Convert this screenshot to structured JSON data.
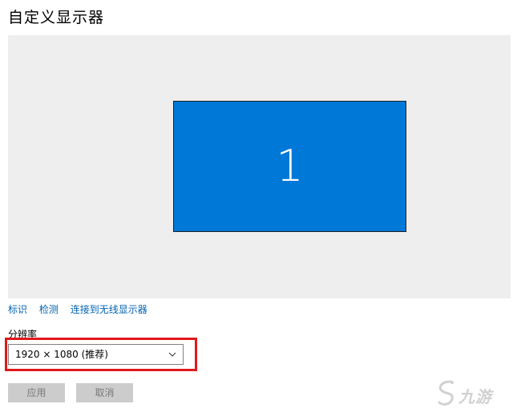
{
  "header": {
    "title": "自定义显示器"
  },
  "display": {
    "monitor_number": "1",
    "monitor_color": "#0078d7",
    "canvas_color": "#eeeeee"
  },
  "links": {
    "identify": "标识",
    "detect": "检测",
    "connect_wireless": "连接到无线显示器"
  },
  "resolution": {
    "label": "分辨率",
    "selected_value": "1920 × 1080 (推荐)",
    "highlight_color": "#e0181b"
  },
  "buttons": {
    "apply": "应用",
    "cancel": "取消"
  },
  "watermark": {
    "text": "九游",
    "icon": "swirl-logo-icon"
  },
  "icons": {
    "dropdown": "chevron-down-icon"
  }
}
